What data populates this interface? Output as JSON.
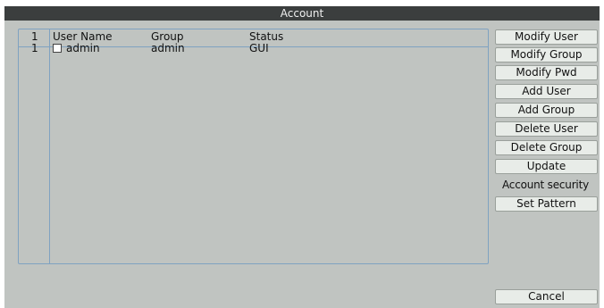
{
  "window": {
    "title": "Account"
  },
  "table": {
    "header": {
      "index": "1",
      "columns": [
        "User Name",
        "Group",
        "Status"
      ]
    },
    "rows": [
      {
        "index": "1",
        "checked": false,
        "user_name": "admin",
        "group": "admin",
        "status": "GUI"
      }
    ]
  },
  "actions": {
    "modify_user": "Modify User",
    "modify_group": "Modify Group",
    "modify_pwd": "Modify Pwd",
    "add_user": "Add User",
    "add_group": "Add Group",
    "delete_user": "Delete User",
    "delete_group": "Delete Group",
    "update": "Update",
    "account_security": "Account security",
    "set_pattern": "Set Pattern",
    "cancel": "Cancel"
  },
  "colors": {
    "title_bar": "#3b3e3e",
    "panel": "#c0c4c1",
    "grid_line": "#7fa2c1",
    "button_face": "#e8ece8"
  }
}
